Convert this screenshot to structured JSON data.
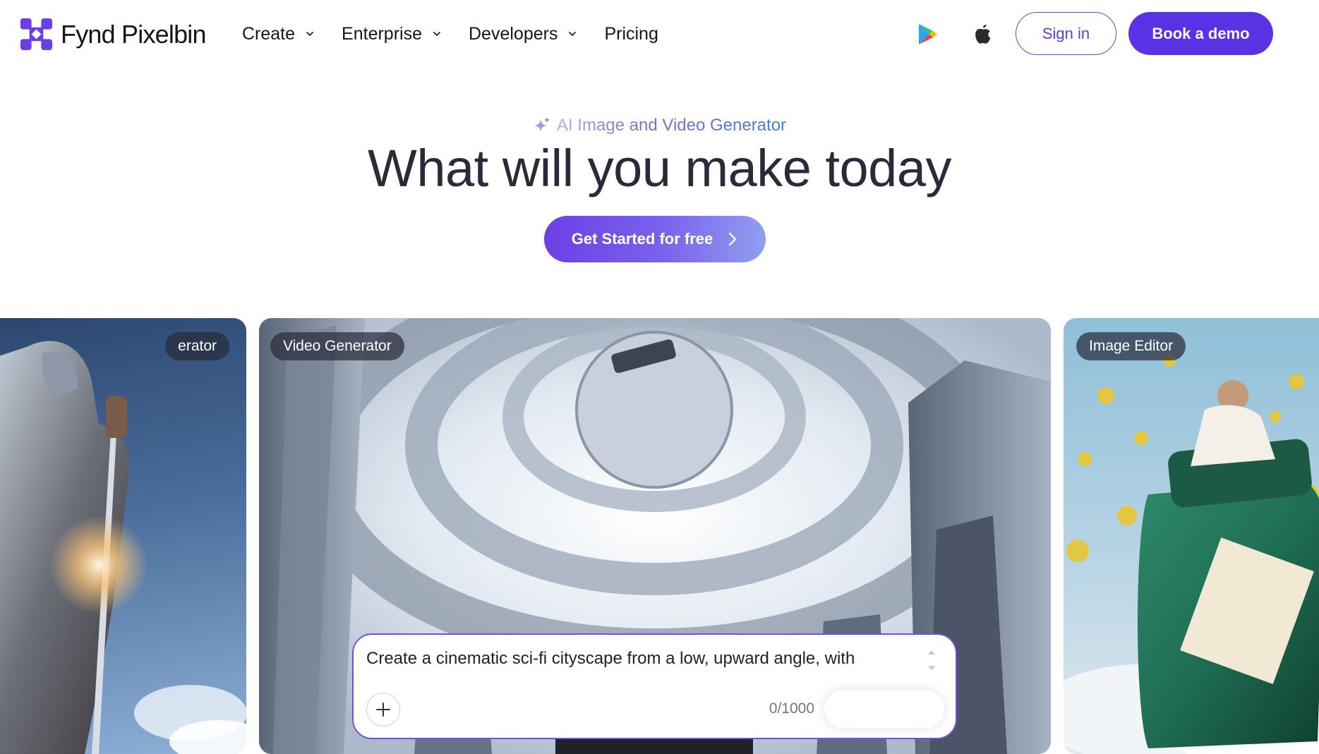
{
  "brand": {
    "name": "Fynd Pixelbin",
    "accent": "#5b31e6",
    "logo_color": "#6a3fe8"
  },
  "nav": {
    "items": [
      {
        "label": "Create",
        "has_dropdown": true
      },
      {
        "label": "Enterprise",
        "has_dropdown": true
      },
      {
        "label": "Developers",
        "has_dropdown": true
      },
      {
        "label": "Pricing",
        "has_dropdown": false
      }
    ],
    "icons": [
      "google-play-icon",
      "apple-icon"
    ],
    "signin_label": "Sign in",
    "demo_label": "Book a demo"
  },
  "hero": {
    "eyebrow": "AI Image and Video Generator",
    "headline": "What will you make today",
    "cta_label": "Get Started for free"
  },
  "cards": [
    {
      "tag": "erator"
    },
    {
      "tag": "Video Generator"
    },
    {
      "tag": "Image Editor"
    }
  ],
  "prompt": {
    "text": "Create a cinematic sci-fi cityscape from a low, upward angle, with",
    "counter": "0/1000"
  }
}
